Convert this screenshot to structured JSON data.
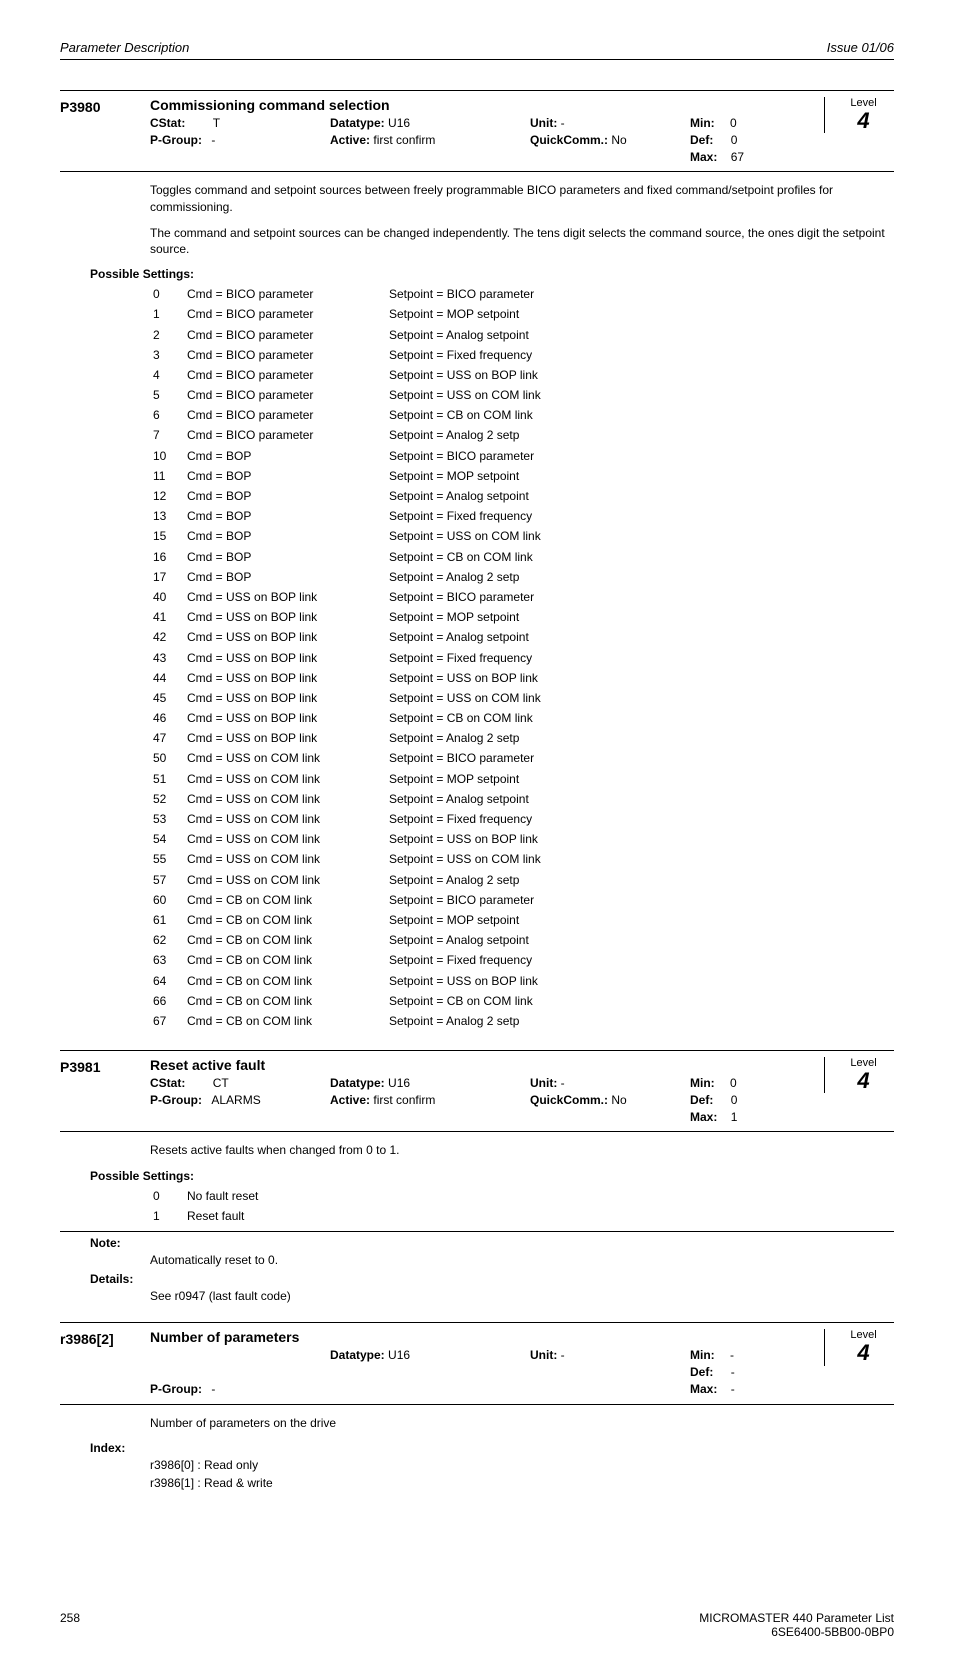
{
  "header": {
    "left": "Parameter Description",
    "right": "Issue 01/06"
  },
  "footer": {
    "page": "258",
    "line1": "MICROMASTER 440    Parameter List",
    "line2": "6SE6400-5BB00-0BP0"
  },
  "p3980": {
    "id": "P3980",
    "title": "Commissioning command selection",
    "cstat_label": "CStat:",
    "cstat": "T",
    "datatype_label": "Datatype:",
    "datatype": "U16",
    "unit_label": "Unit:",
    "unit": "-",
    "min_label": "Min:",
    "min": "0",
    "pgroup_label": "P-Group:",
    "pgroup": "-",
    "active_label": "Active:",
    "active": "first confirm",
    "quick_label": "QuickComm.:",
    "quick": "No",
    "def_label": "Def:",
    "def": "0",
    "max_label": "Max:",
    "max": "67",
    "level_label": "Level",
    "level": "4",
    "para1": "Toggles command and setpoint sources between freely programmable BICO parameters and fixed command/setpoint profiles for commissioning.",
    "para2": "The command and setpoint sources can be changed independently. The tens digit selects the command source, the ones digit the setpoint source.",
    "settings_label": "Possible Settings:",
    "settings": [
      {
        "n": "0",
        "c": "Cmd = BICO parameter",
        "s": "Setpoint = BICO parameter"
      },
      {
        "n": "1",
        "c": "Cmd = BICO parameter",
        "s": "Setpoint = MOP setpoint"
      },
      {
        "n": "2",
        "c": "Cmd = BICO parameter",
        "s": "Setpoint = Analog setpoint"
      },
      {
        "n": "3",
        "c": "Cmd = BICO parameter",
        "s": "Setpoint = Fixed frequency"
      },
      {
        "n": "4",
        "c": "Cmd = BICO parameter",
        "s": "Setpoint = USS on BOP link"
      },
      {
        "n": "5",
        "c": "Cmd = BICO parameter",
        "s": "Setpoint = USS on COM link"
      },
      {
        "n": "6",
        "c": "Cmd = BICO parameter",
        "s": "Setpoint = CB  on COM link"
      },
      {
        "n": "7",
        "c": "Cmd = BICO parameter",
        "s": "Setpoint = Analog 2 setp"
      },
      {
        "n": "10",
        "c": "Cmd = BOP",
        "s": "Setpoint = BICO parameter"
      },
      {
        "n": "11",
        "c": "Cmd = BOP",
        "s": "Setpoint = MOP setpoint"
      },
      {
        "n": "12",
        "c": "Cmd = BOP",
        "s": "Setpoint = Analog setpoint"
      },
      {
        "n": "13",
        "c": "Cmd = BOP",
        "s": "Setpoint = Fixed frequency"
      },
      {
        "n": "15",
        "c": "Cmd = BOP",
        "s": "Setpoint = USS on COM link"
      },
      {
        "n": "16",
        "c": "Cmd = BOP",
        "s": "Setpoint = CB  on COM link"
      },
      {
        "n": "17",
        "c": "Cmd = BOP",
        "s": "Setpoint = Analog 2 setp"
      },
      {
        "n": "40",
        "c": "Cmd = USS on BOP link",
        "s": "Setpoint = BICO parameter"
      },
      {
        "n": "41",
        "c": "Cmd = USS on BOP link",
        "s": "Setpoint = MOP setpoint"
      },
      {
        "n": "42",
        "c": "Cmd = USS on BOP link",
        "s": "Setpoint = Analog setpoint"
      },
      {
        "n": "43",
        "c": "Cmd = USS on BOP link",
        "s": "Setpoint = Fixed frequency"
      },
      {
        "n": "44",
        "c": "Cmd = USS on BOP link",
        "s": "Setpoint = USS on BOP link"
      },
      {
        "n": "45",
        "c": "Cmd = USS on BOP link",
        "s": "Setpoint = USS on COM link"
      },
      {
        "n": "46",
        "c": "Cmd = USS on BOP link",
        "s": "Setpoint = CB  on COM link"
      },
      {
        "n": "47",
        "c": "Cmd = USS on BOP link",
        "s": "Setpoint = Analog 2 setp"
      },
      {
        "n": "50",
        "c": "Cmd = USS on COM link",
        "s": "Setpoint = BICO parameter"
      },
      {
        "n": "51",
        "c": "Cmd = USS on COM link",
        "s": "Setpoint = MOP setpoint"
      },
      {
        "n": "52",
        "c": "Cmd = USS on COM link",
        "s": "Setpoint = Analog setpoint"
      },
      {
        "n": "53",
        "c": "Cmd = USS on COM link",
        "s": "Setpoint = Fixed frequency"
      },
      {
        "n": "54",
        "c": "Cmd = USS on COM link",
        "s": "Setpoint = USS on BOP link"
      },
      {
        "n": "55",
        "c": "Cmd = USS on COM link",
        "s": "Setpoint = USS on COM link"
      },
      {
        "n": "57",
        "c": "Cmd = USS on COM link",
        "s": "Setpoint = Analog 2 setp"
      },
      {
        "n": "60",
        "c": "Cmd = CB  on COM link",
        "s": "Setpoint = BICO parameter"
      },
      {
        "n": "61",
        "c": "Cmd = CB  on COM link",
        "s": "Setpoint = MOP setpoint"
      },
      {
        "n": "62",
        "c": "Cmd = CB  on COM link",
        "s": "Setpoint = Analog setpoint"
      },
      {
        "n": "63",
        "c": "Cmd = CB  on COM link",
        "s": "Setpoint = Fixed frequency"
      },
      {
        "n": "64",
        "c": "Cmd = CB  on COM link",
        "s": "Setpoint = USS on BOP link"
      },
      {
        "n": "66",
        "c": "Cmd = CB  on COM link",
        "s": "Setpoint = CB  on COM link"
      },
      {
        "n": "67",
        "c": "Cmd = CB  on COM link",
        "s": "Setpoint = Analog 2 setp"
      }
    ]
  },
  "p3981": {
    "id": "P3981",
    "title": "Reset active fault",
    "cstat_label": "CStat:",
    "cstat": "CT",
    "datatype_label": "Datatype:",
    "datatype": "U16",
    "unit_label": "Unit:",
    "unit": "-",
    "min_label": "Min:",
    "min": "0",
    "pgroup_label": "P-Group:",
    "pgroup": "ALARMS",
    "active_label": "Active:",
    "active": "first confirm",
    "quick_label": "QuickComm.:",
    "quick": "No",
    "def_label": "Def:",
    "def": "0",
    "max_label": "Max:",
    "max": "1",
    "level_label": "Level",
    "level": "4",
    "para1": "Resets active faults when changed from 0 to 1.",
    "settings_label": "Possible Settings:",
    "settings": [
      {
        "n": "0",
        "c": "No fault reset"
      },
      {
        "n": "1",
        "c": "Reset fault"
      }
    ],
    "note_label": "Note:",
    "note": "Automatically reset to 0.",
    "details_label": "Details:",
    "details": "See r0947 (last fault code)"
  },
  "r3986": {
    "id": "r3986[2]",
    "title": "Number of parameters",
    "datatype_label": "Datatype:",
    "datatype": "U16",
    "unit_label": "Unit:",
    "unit": "-",
    "min_label": "Min:",
    "min": "-",
    "pgroup_label": "P-Group:",
    "pgroup": "-",
    "def_label": "Def:",
    "def": "-",
    "max_label": "Max:",
    "max": "-",
    "level_label": "Level",
    "level": "4",
    "para1": "Number of parameters on the drive",
    "index_label": "Index:",
    "index0": "r3986[0]  :  Read only",
    "index1": "r3986[1]  :  Read & write"
  }
}
